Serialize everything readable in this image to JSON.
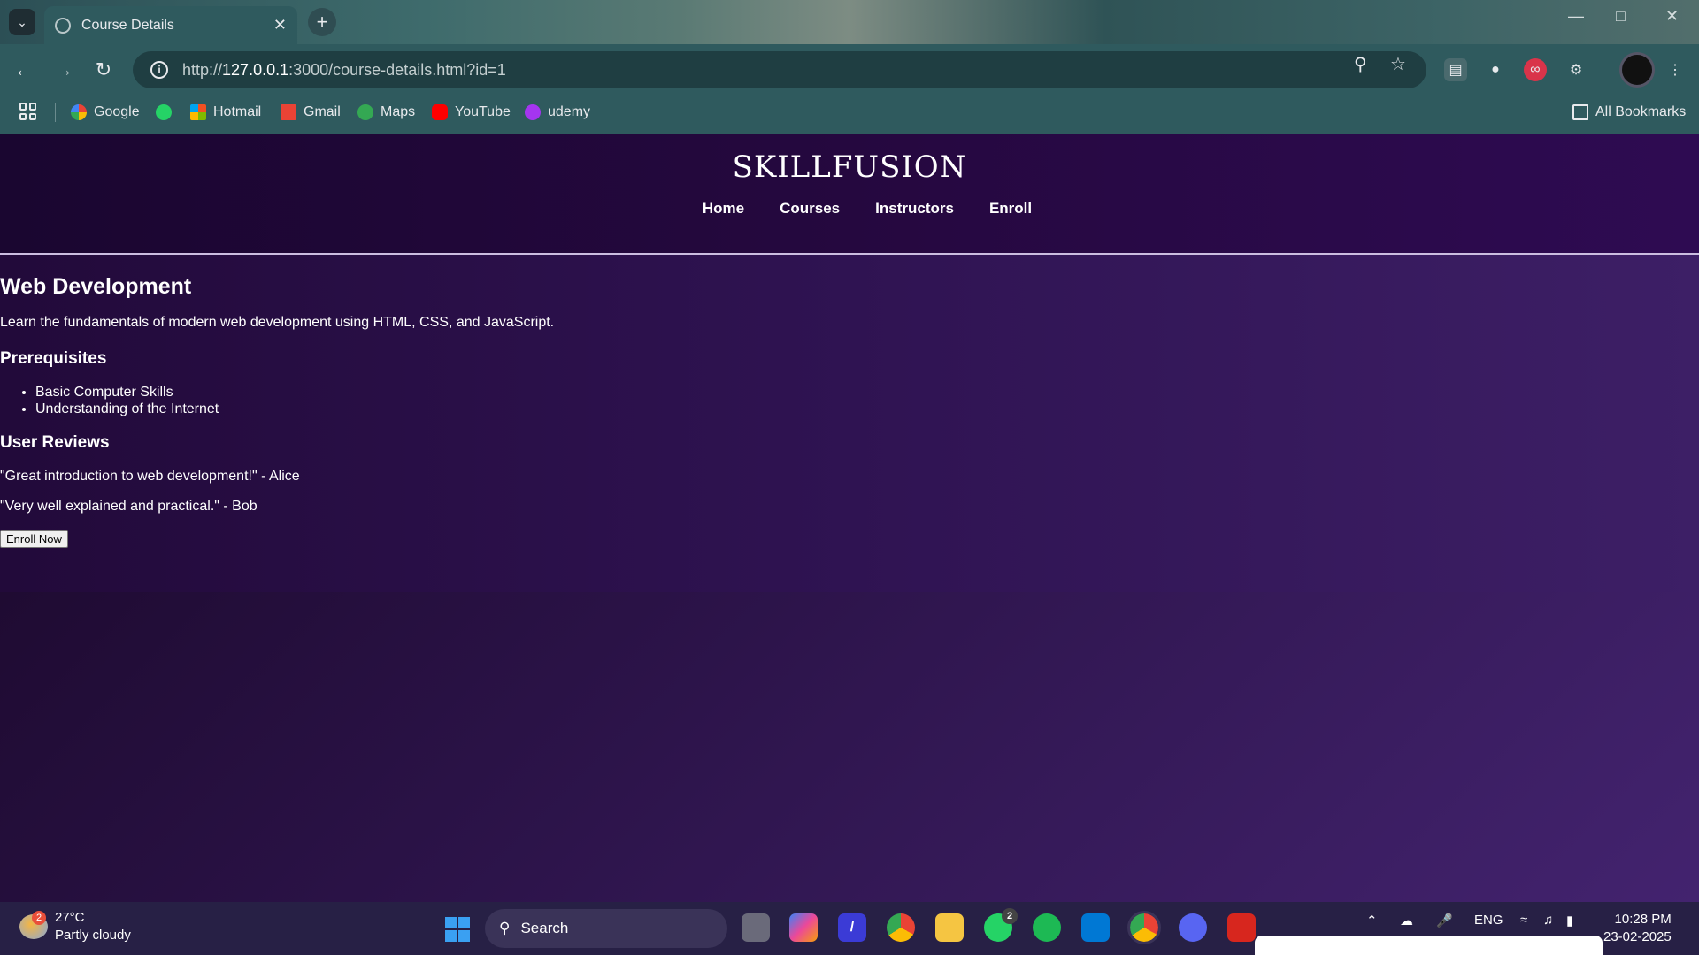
{
  "browser": {
    "tab_title": "Course Details",
    "url_prefix": "http://",
    "url_host": "127.0.0.1",
    "url_rest": ":3000/course-details.html?id=1",
    "bookmarks": [
      "Google",
      "Hotmail",
      "Gmail",
      "Maps",
      "YouTube",
      "udemy"
    ],
    "all_bookmarks": "All Bookmarks"
  },
  "site": {
    "logo": "SKILLFUSION",
    "nav": [
      "Home",
      "Courses",
      "Instructors",
      "Enroll"
    ]
  },
  "course": {
    "title": "Web Development",
    "description": "Learn the fundamentals of modern web development using HTML, CSS, and JavaScript.",
    "prereq_heading": "Prerequisites",
    "prerequisites": [
      "Basic Computer Skills",
      "Understanding of the Internet"
    ],
    "reviews_heading": "User Reviews",
    "reviews": [
      "\"Great introduction to web development!\" - Alice",
      "\"Very well explained and practical.\" - Bob"
    ],
    "enroll_button": "Enroll Now"
  },
  "taskbar": {
    "weather_temp": "27°C",
    "weather_desc": "Partly cloudy",
    "weather_badge": "2",
    "search_label": "Search",
    "whatsapp_badge": "2",
    "lang": "ENG",
    "time": "10:28 PM",
    "date": "23-02-2025"
  },
  "colors": {
    "page_bg_start": "#170624",
    "page_bg_end": "#43236f",
    "browser_chrome": "#2f5a5e",
    "taskbar": "#272045"
  }
}
